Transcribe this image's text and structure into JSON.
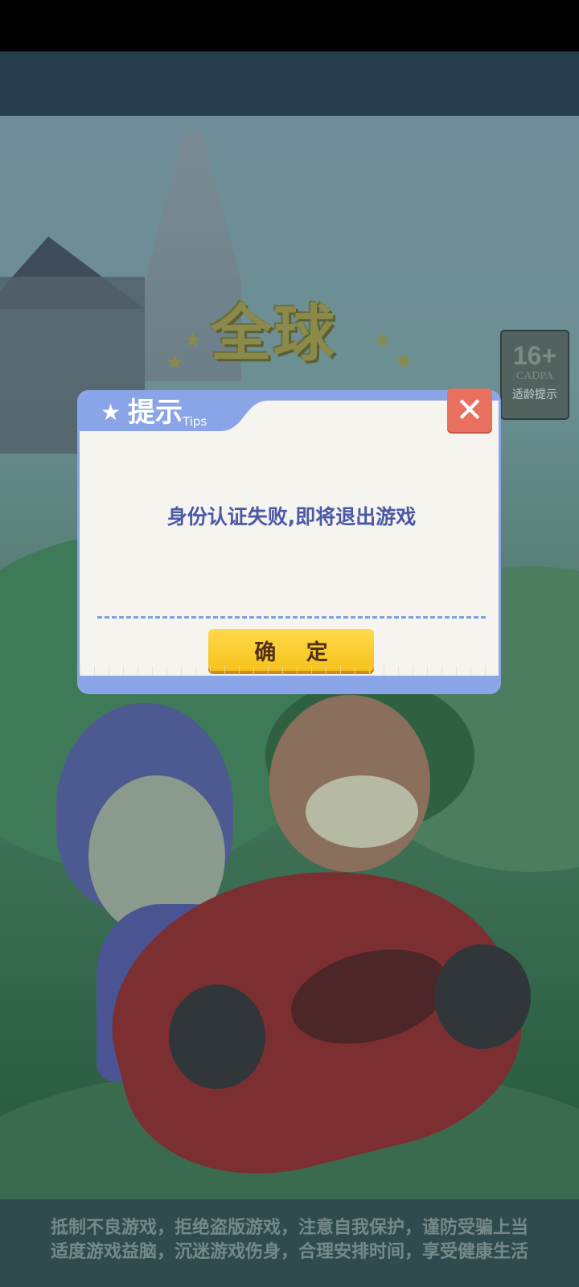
{
  "logo": {
    "text": "全球"
  },
  "age_rating": {
    "number": "16+",
    "org": "CADPA",
    "label": "适龄提示"
  },
  "dialog": {
    "title": "提示",
    "title_en": "Tips",
    "message": "身份认证失败,即将退出游戏",
    "confirm_label": "确 定",
    "close_symbol": "✕",
    "star_symbol": "★"
  },
  "footer": {
    "line1": "抵制不良游戏，拒绝盗版游戏，注意自我保护，谨防受骗上当",
    "line2": "适度游戏益脑，沉迷游戏伤身，合理安排时间，享受健康生活"
  },
  "colors": {
    "dialog_border": "#8aa4e8",
    "close_button": "#e9705f",
    "confirm_button": "#f6c21c",
    "message_text": "#4a58a6"
  }
}
